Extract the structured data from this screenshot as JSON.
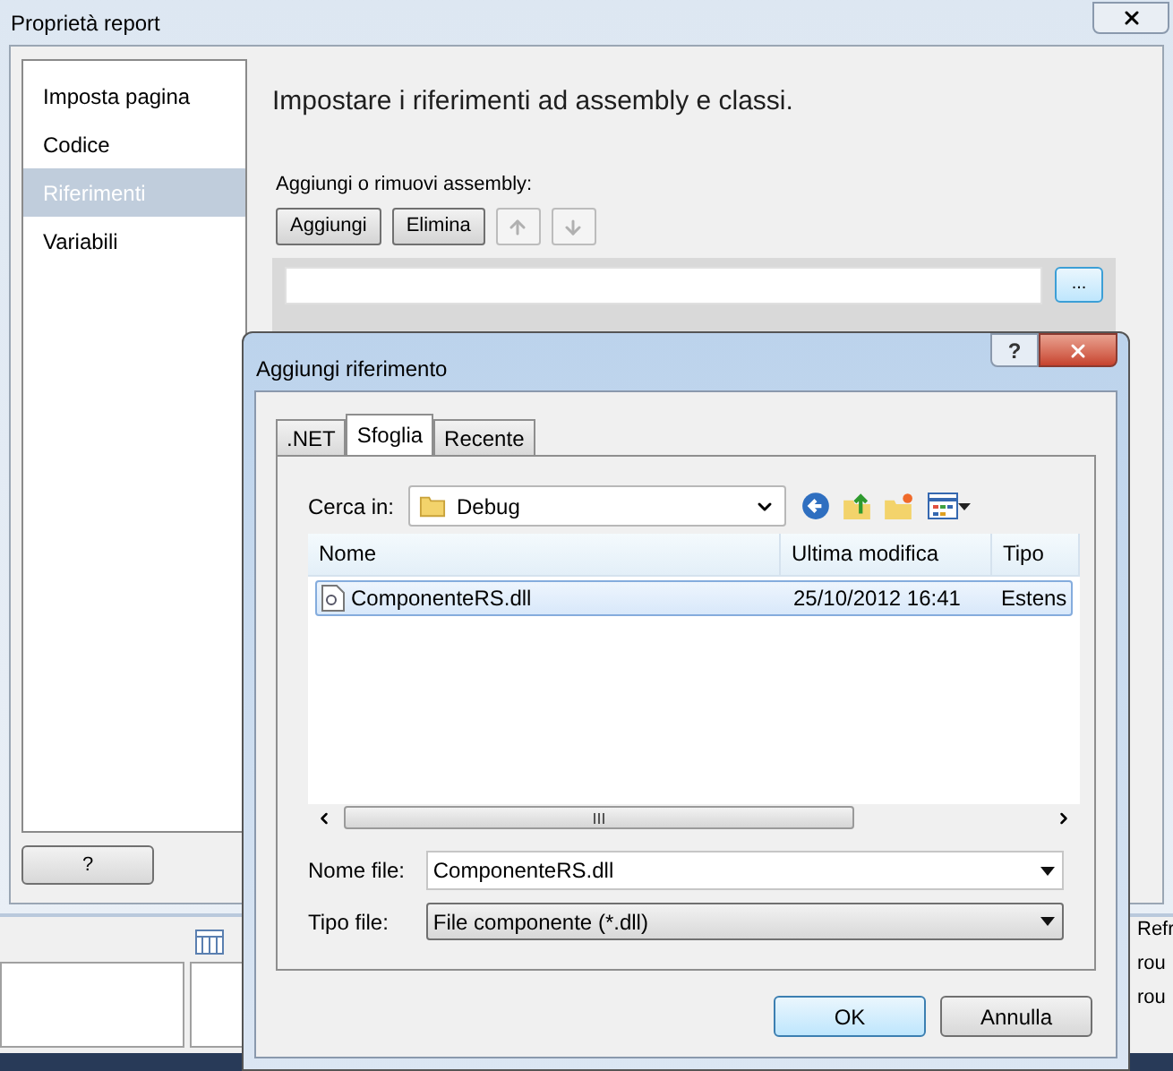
{
  "window": {
    "title": "Proprietà report"
  },
  "sidebar": {
    "items": [
      {
        "label": "Imposta pagina",
        "selected": false
      },
      {
        "label": "Codice",
        "selected": false
      },
      {
        "label": "Riferimenti",
        "selected": true
      },
      {
        "label": "Variabili",
        "selected": false
      }
    ]
  },
  "heading": "Impostare i riferimenti ad assembly e classi.",
  "assembly_section": {
    "label": "Aggiungi o rimuovi assembly:",
    "buttons": [
      "Aggiungi",
      "Elimina"
    ],
    "move_up_disabled": true,
    "move_down_disabled": true,
    "browse_button": "..."
  },
  "help_button": "?",
  "background_texts": [
    "Refr",
    "rou",
    "rou"
  ],
  "dialog": {
    "title": "Aggiungi riferimento",
    "help_glyph": "?",
    "tabs": [
      {
        "label": ".NET",
        "selected": false
      },
      {
        "label": "Sfoglia",
        "selected": true
      },
      {
        "label": "Recente",
        "selected": false
      }
    ],
    "look_in": {
      "label": "Cerca in:",
      "value": "Debug"
    },
    "columns": [
      "Nome",
      "Ultima modifica",
      "Tipo"
    ],
    "rows": [
      {
        "name": "ComponenteRS.dll",
        "modified": "25/10/2012 16:41",
        "type": "Estens",
        "selected": true
      }
    ],
    "file_name": {
      "label": "Nome file:",
      "value": "ComponenteRS.dll"
    },
    "file_type": {
      "label": "Tipo file:",
      "value": "File componente (*.dll)"
    },
    "buttons": [
      {
        "label": "OK",
        "default": true
      },
      {
        "label": "Annulla",
        "default": false
      }
    ]
  }
}
